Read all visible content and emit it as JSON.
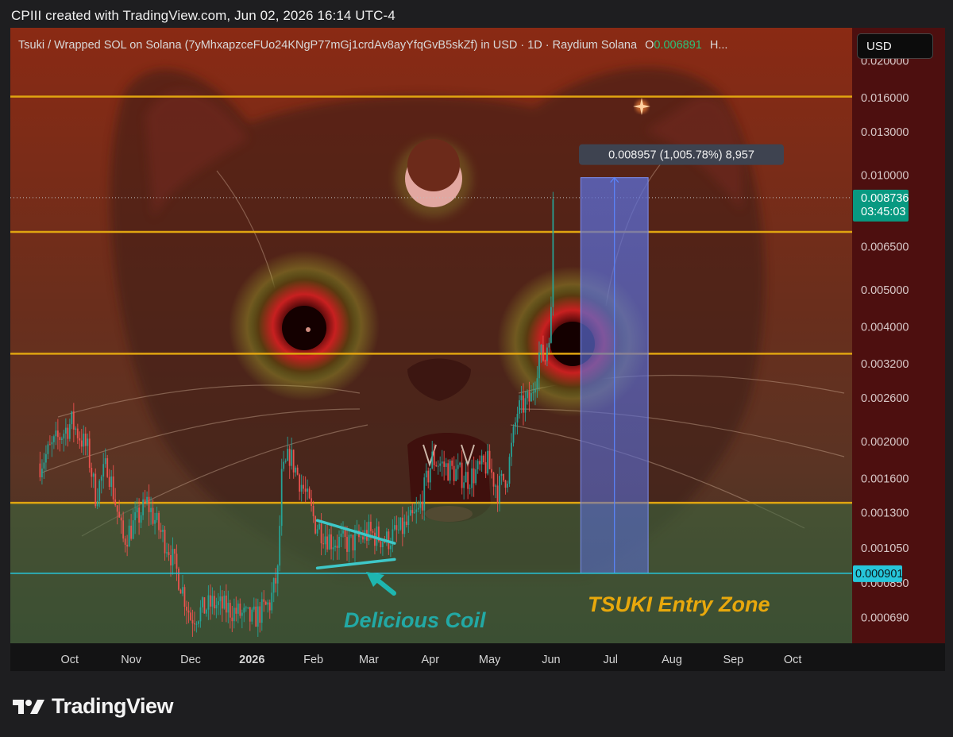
{
  "header": {
    "credit": "CPIII created with TradingView.com, Jun 02, 2026 16:14 UTC-4"
  },
  "symbol": {
    "title": "Tsuki / Wrapped SOL on Solana (7yMhxapzceFUo24KNgP77mGj1crdAv8ayYfqGvB5skZf) in USD · 1D · Raydium Solana",
    "open_label": "O",
    "open_value": "0.006891",
    "more": "H..."
  },
  "currency_button": "USD",
  "brand": {
    "name": "TradingView",
    "icon": "tradingview-logo-icon"
  },
  "colors": {
    "horizontal_line": "#e0a410",
    "entry_line": "#26c6da",
    "annotation_text": "#22a9a5",
    "entry_zone_text": "#e8a80c",
    "price_box": "#089981",
    "bullish": "#26a69a",
    "bearish": "#ef5350",
    "projection_box": "#5b6fd9"
  },
  "chart_data": {
    "type": "candlestick",
    "scale": "log",
    "timeframe": "1D",
    "x_ticks": [
      "Oct",
      "Nov",
      "Dec",
      "2026",
      "Feb",
      "Mar",
      "Apr",
      "May",
      "Jun",
      "Jul",
      "Aug",
      "Sep",
      "Oct"
    ],
    "y_ticks": [
      "0.020000",
      "0.016000",
      "0.013000",
      "0.010000",
      "0.006500",
      "0.005000",
      "0.004000",
      "0.003200",
      "0.002600",
      "0.002000",
      "0.001600",
      "0.001300",
      "0.001050",
      "0.000850",
      "0.000690"
    ],
    "y_range": [
      0.00059,
      0.0244
    ],
    "horizontal_levels": [
      0.0161,
      0.0071,
      0.0034,
      0.00138
    ],
    "entry_level": 0.000901,
    "current_price": {
      "value": "0.008736",
      "countdown": "03:45:03"
    },
    "entry_price_label": "0.000901",
    "price_path": [
      [
        "2025-09-16",
        0.00175
      ],
      [
        "2025-09-24",
        0.002
      ],
      [
        "2025-10-02",
        0.00225
      ],
      [
        "2025-10-10",
        0.0019
      ],
      [
        "2025-10-14",
        0.00145
      ],
      [
        "2025-10-20",
        0.00175
      ],
      [
        "2025-10-28",
        0.0011
      ],
      [
        "2025-11-04",
        0.00125
      ],
      [
        "2025-11-09",
        0.00138
      ],
      [
        "2025-11-15",
        0.00118
      ],
      [
        "2025-11-20",
        0.00105
      ],
      [
        "2025-11-26",
        0.00085
      ],
      [
        "2025-12-01",
        0.00069
      ],
      [
        "2025-12-12",
        0.00075
      ],
      [
        "2025-12-22",
        0.00072
      ],
      [
        "2026-01-01",
        0.00068
      ],
      [
        "2026-01-10",
        0.00075
      ],
      [
        "2026-01-14",
        0.0009
      ],
      [
        "2026-01-16",
        0.0016
      ],
      [
        "2026-01-20",
        0.00185
      ],
      [
        "2026-01-27",
        0.0015
      ],
      [
        "2026-02-02",
        0.00122
      ],
      [
        "2026-02-10",
        0.0011
      ],
      [
        "2026-02-20",
        0.00108
      ],
      [
        "2026-03-01",
        0.00115
      ],
      [
        "2026-03-10",
        0.0011
      ],
      [
        "2026-03-20",
        0.0012
      ],
      [
        "2026-03-26",
        0.0013
      ],
      [
        "2026-04-02",
        0.0018
      ],
      [
        "2026-04-10",
        0.0017
      ],
      [
        "2026-04-20",
        0.0016
      ],
      [
        "2026-04-30",
        0.00175
      ],
      [
        "2026-05-05",
        0.0015
      ],
      [
        "2026-05-10",
        0.00165
      ],
      [
        "2026-05-15",
        0.0024
      ],
      [
        "2026-05-22",
        0.0026
      ],
      [
        "2026-05-26",
        0.0034
      ],
      [
        "2026-05-29",
        0.0033
      ],
      [
        "2026-06-01",
        0.0043
      ],
      [
        "2026-06-02",
        0.00873
      ]
    ],
    "projection": {
      "start_date": "2026-06-16",
      "end_date": "2026-07-20",
      "low": 0.000901,
      "high": 0.00986,
      "label": "0.008957 (1,005.78%) 8,957"
    },
    "coil": {
      "upper": [
        [
          "2026-02-03",
          0.00124
        ],
        [
          "2026-03-14",
          0.00108
        ]
      ],
      "lower": [
        [
          "2026-02-03",
          0.00093
        ],
        [
          "2026-03-14",
          0.00098
        ]
      ]
    },
    "annotations": {
      "coil": "Delicious Coil",
      "entry_zone": "TSUKI Entry Zone"
    }
  }
}
